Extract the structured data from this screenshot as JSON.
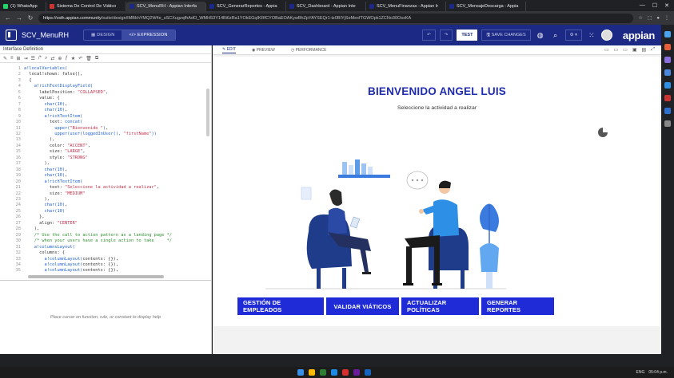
{
  "browser": {
    "tabs": [
      {
        "label": "(1) WhatsApp",
        "color": "#25d366",
        "active": false
      },
      {
        "label": "Sistema De Control De Viático",
        "color": "#cc3333",
        "active": false
      },
      {
        "label": "SCV_MenuRH - Appian Interfa",
        "color": "#1c2a86",
        "active": true
      },
      {
        "label": "SCV_GenerarReportes - Appia",
        "color": "#1c2a86",
        "active": false
      },
      {
        "label": "SCV_Dashboard - Appian Inte",
        "color": "#1c2a86",
        "active": false
      },
      {
        "label": "SCV_MenuFinanzas - Appian Ir",
        "color": "#1c2a86",
        "active": false
      },
      {
        "label": "SCV_MensajeDescarga - Appia",
        "color": "#1c2a86",
        "active": false
      }
    ],
    "url_host": "https://vsth.appian.community",
    "url_path": "/suite/design/IMBkhYMQ2W4e_sSCXugzqfhAdO_WMH53Y14Bi6zRa1YOkEGqIKRfCYOBaEOAKywBhZpYAYSEQr1-tz0BIYjSeMexfTGWOpk1ZCNo30OsxKA"
  },
  "appbar": {
    "app_name": "SCV_MenuRH",
    "mode_design": "DESIGN",
    "mode_expression": "EXPRESSION",
    "test_label": "TEST",
    "save_label": "SAVE CHANGES",
    "brand": "appian"
  },
  "left": {
    "title": "Interface Definition",
    "help_text": "Place cursor on function, rule, or constant to display help",
    "lines": [
      "1",
      "2",
      "3",
      "4",
      "5",
      "6",
      "7",
      "8",
      "9",
      "10",
      "11",
      "12",
      "13",
      "14",
      "15",
      "16",
      "17",
      "18",
      "19",
      "20",
      "21",
      "22",
      "23",
      "24",
      "25",
      "26",
      "27",
      "28",
      "29",
      "30",
      "31",
      "32",
      "33",
      "34",
      "35"
    ]
  },
  "right": {
    "tab_edit": "EDIT",
    "tab_preview": "PREVIEW",
    "tab_performance": "PERFORMANCE",
    "heading": "BIENVENIDO ANGEL LUIS",
    "subtitle": "Seleccione la actividad a realizar",
    "actions": [
      "GESTIÓN DE EMPLEADOS",
      "VALIDAR VIÁTICOS",
      "ACTUALIZAR POLÍTICAS",
      "GENERAR REPORTES"
    ]
  },
  "colors": {
    "appbar": "#1c2a86",
    "accent": "#1f2bb0",
    "button": "#1f2bd6"
  },
  "taskbar": {
    "temp": "ENG",
    "time": "05:04 p.m."
  }
}
